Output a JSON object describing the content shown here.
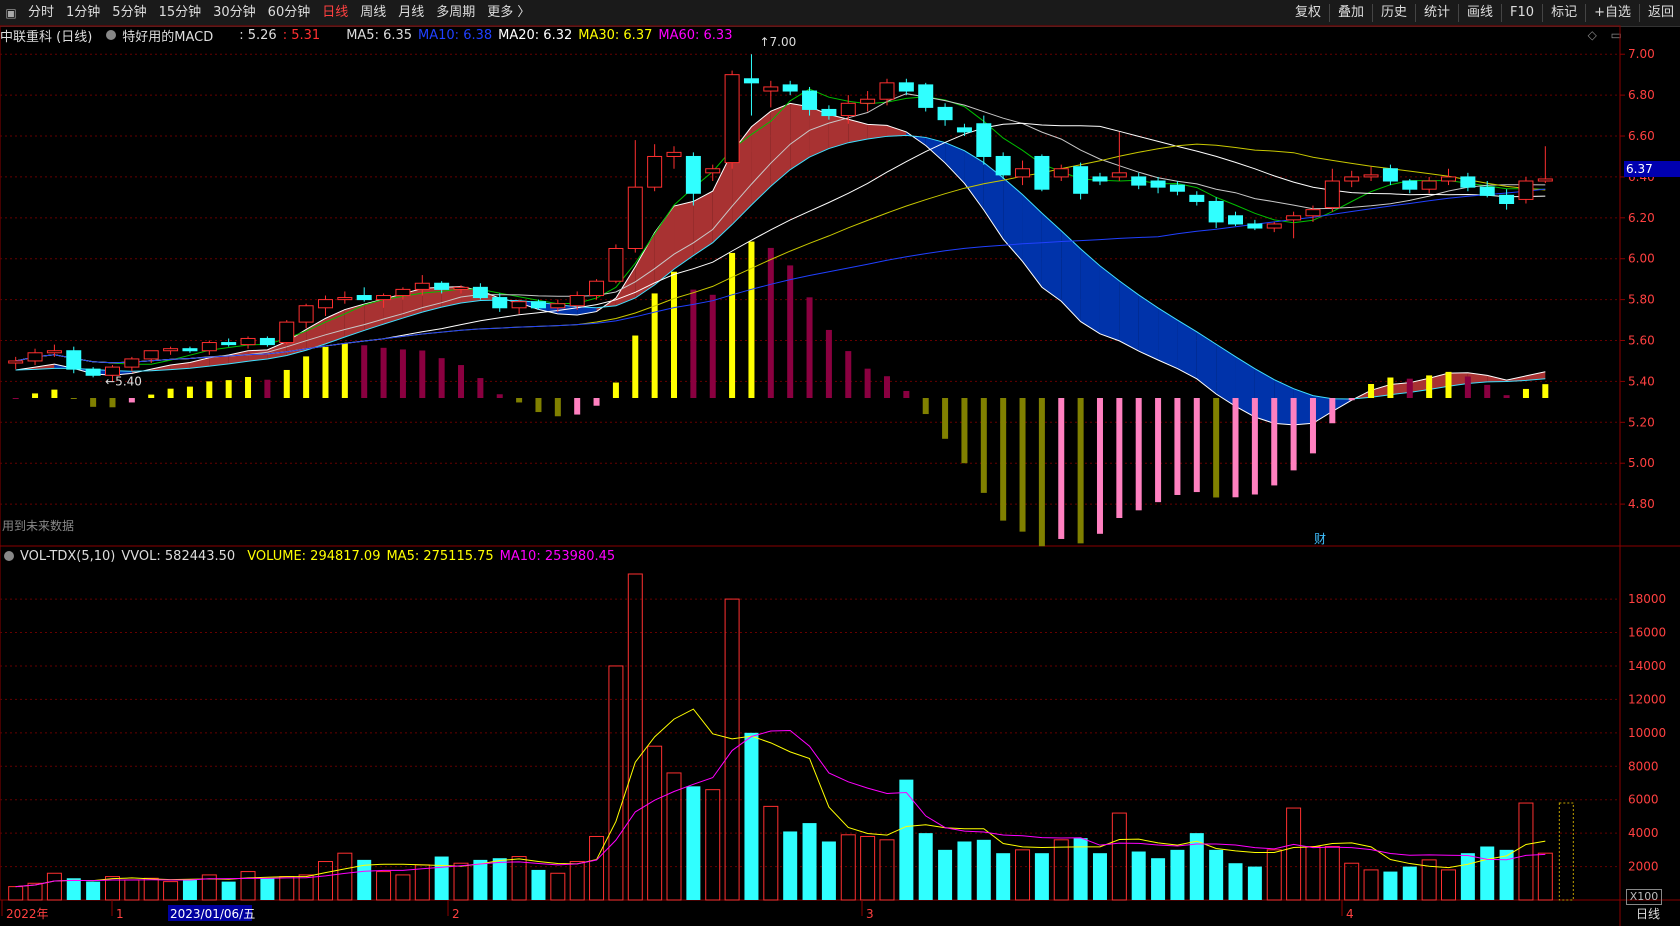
{
  "toolbar": {
    "periods": [
      "分时",
      "1分钟",
      "5分钟",
      "15分钟",
      "30分钟",
      "60分钟",
      "日线",
      "周线",
      "月线",
      "多周期",
      "更多 〉"
    ],
    "active": "日线",
    "right_items": [
      "复权",
      "叠加",
      "历史",
      "统计",
      "画线",
      "F10",
      "标记",
      "+自选",
      "返回"
    ]
  },
  "info": {
    "stock": "中联重科 (日线)",
    "indicator": "特好用的MACD",
    "v1": ": 5.26",
    "v2": ": 5.31",
    "ma5": "MA5: 6.35",
    "ma10": "MA10: 6.38",
    "ma20": "MA20: 6.32",
    "ma30": "MA30: 6.37",
    "ma60": "MA60: 6.33"
  },
  "volinfo": {
    "name": "VOL-TDX(5,10)",
    "vvol": "VVOL: 582443.50",
    "volume": "VOLUME: 294817.09",
    "ma5": "MA5: 275115.75",
    "ma10": "MA10: 253980.45"
  },
  "price_axis": [
    "7.00",
    "6.80",
    "6.60",
    "6.40",
    "6.20",
    "6.00",
    "5.80",
    "5.60",
    "5.40",
    "5.20",
    "5.00",
    "4.80"
  ],
  "volume_axis": [
    "18000",
    "16000",
    "14000",
    "12000",
    "10000",
    "8000",
    "6000",
    "4000",
    "2000"
  ],
  "current_price": "6.37",
  "high_mark": "7.00",
  "low_mark": "5.40",
  "future_note": "用到未来数据",
  "fin_mark": "财",
  "vol_unit": "X100",
  "period_label": "日线",
  "date_axis": {
    "year": "2022年",
    "m1": "1",
    "date": "2023/01/06/五",
    "m2": "2",
    "m3": "3",
    "m4": "4"
  },
  "colors": {
    "up": "#ff3030",
    "down": "#30ffff",
    "ma5": "#e0e0e0",
    "ma10": "#2040ff",
    "ma20": "#ffffff",
    "ma30": "#ffff00",
    "ma60": "#ff00ff",
    "grid": "#660000"
  },
  "chart_data": {
    "type": "candlestick",
    "ylim": [
      4.6,
      7.05
    ],
    "candles": [
      [
        5.49,
        5.52,
        5.46,
        5.5
      ],
      [
        5.5,
        5.56,
        5.48,
        5.54
      ],
      [
        5.54,
        5.58,
        5.52,
        5.55
      ],
      [
        5.55,
        5.57,
        5.44,
        5.46
      ],
      [
        5.46,
        5.47,
        5.42,
        5.43
      ],
      [
        5.43,
        5.48,
        5.4,
        5.47
      ],
      [
        5.47,
        5.52,
        5.45,
        5.51
      ],
      [
        5.51,
        5.55,
        5.49,
        5.55
      ],
      [
        5.55,
        5.57,
        5.53,
        5.56
      ],
      [
        5.56,
        5.57,
        5.54,
        5.55
      ],
      [
        5.55,
        5.6,
        5.53,
        5.59
      ],
      [
        5.59,
        5.61,
        5.57,
        5.58
      ],
      [
        5.58,
        5.62,
        5.56,
        5.61
      ],
      [
        5.61,
        5.62,
        5.57,
        5.58
      ],
      [
        5.59,
        5.7,
        5.58,
        5.69
      ],
      [
        5.69,
        5.78,
        5.66,
        5.77
      ],
      [
        5.76,
        5.82,
        5.72,
        5.8
      ],
      [
        5.8,
        5.84,
        5.78,
        5.81
      ],
      [
        5.82,
        5.86,
        5.79,
        5.8
      ],
      [
        5.8,
        5.83,
        5.76,
        5.82
      ],
      [
        5.82,
        5.86,
        5.8,
        5.85
      ],
      [
        5.85,
        5.92,
        5.82,
        5.88
      ],
      [
        5.88,
        5.89,
        5.83,
        5.85
      ],
      [
        5.85,
        5.87,
        5.83,
        5.86
      ],
      [
        5.86,
        5.88,
        5.8,
        5.81
      ],
      [
        5.81,
        5.83,
        5.74,
        5.76
      ],
      [
        5.76,
        5.8,
        5.73,
        5.79
      ],
      [
        5.79,
        5.8,
        5.75,
        5.76
      ],
      [
        5.76,
        5.8,
        5.74,
        5.78
      ],
      [
        5.77,
        5.84,
        5.75,
        5.82
      ],
      [
        5.82,
        5.9,
        5.8,
        5.89
      ],
      [
        5.89,
        6.07,
        5.88,
        6.05
      ],
      [
        6.05,
        6.58,
        6.03,
        6.35
      ],
      [
        6.35,
        6.56,
        6.33,
        6.5
      ],
      [
        6.5,
        6.55,
        6.44,
        6.52
      ],
      [
        6.5,
        6.52,
        6.26,
        6.32
      ],
      [
        6.42,
        6.46,
        6.38,
        6.44
      ],
      [
        6.47,
        6.92,
        6.44,
        6.9
      ],
      [
        6.88,
        7.0,
        6.7,
        6.86
      ],
      [
        6.82,
        6.87,
        6.74,
        6.84
      ],
      [
        6.85,
        6.87,
        6.8,
        6.82
      ],
      [
        6.82,
        6.84,
        6.7,
        6.73
      ],
      [
        6.73,
        6.75,
        6.68,
        6.7
      ],
      [
        6.7,
        6.8,
        6.66,
        6.76
      ],
      [
        6.76,
        6.82,
        6.72,
        6.78
      ],
      [
        6.78,
        6.88,
        6.75,
        6.86
      ],
      [
        6.86,
        6.88,
        6.8,
        6.82
      ],
      [
        6.85,
        6.86,
        6.72,
        6.74
      ],
      [
        6.74,
        6.76,
        6.65,
        6.68
      ],
      [
        6.64,
        6.66,
        6.6,
        6.62
      ],
      [
        6.66,
        6.7,
        6.46,
        6.5
      ],
      [
        6.5,
        6.52,
        6.39,
        6.41
      ],
      [
        6.4,
        6.48,
        6.36,
        6.44
      ],
      [
        6.5,
        6.51,
        6.33,
        6.34
      ],
      [
        6.4,
        6.46,
        6.38,
        6.44
      ],
      [
        6.45,
        6.47,
        6.29,
        6.32
      ],
      [
        6.4,
        6.42,
        6.36,
        6.38
      ],
      [
        6.4,
        6.62,
        6.38,
        6.42
      ],
      [
        6.4,
        6.42,
        6.34,
        6.36
      ],
      [
        6.38,
        6.4,
        6.32,
        6.35
      ],
      [
        6.36,
        6.38,
        6.31,
        6.33
      ],
      [
        6.31,
        6.33,
        6.26,
        6.28
      ],
      [
        6.28,
        6.3,
        6.15,
        6.18
      ],
      [
        6.21,
        6.23,
        6.16,
        6.17
      ],
      [
        6.17,
        6.19,
        6.14,
        6.15
      ],
      [
        6.15,
        6.18,
        6.13,
        6.17
      ],
      [
        6.19,
        6.23,
        6.1,
        6.21
      ],
      [
        6.21,
        6.26,
        6.18,
        6.24
      ],
      [
        6.25,
        6.44,
        6.23,
        6.38
      ],
      [
        6.38,
        6.43,
        6.35,
        6.4
      ],
      [
        6.4,
        6.45,
        6.38,
        6.41
      ],
      [
        6.44,
        6.46,
        6.36,
        6.38
      ],
      [
        6.38,
        6.39,
        6.32,
        6.34
      ],
      [
        6.34,
        6.4,
        6.32,
        6.38
      ],
      [
        6.38,
        6.44,
        6.36,
        6.4
      ],
      [
        6.4,
        6.42,
        6.33,
        6.35
      ],
      [
        6.35,
        6.38,
        6.3,
        6.31
      ],
      [
        6.31,
        6.34,
        6.24,
        6.27
      ],
      [
        6.29,
        6.4,
        6.27,
        6.38
      ],
      [
        6.38,
        6.55,
        6.37,
        6.39
      ]
    ],
    "volume": [
      8,
      10,
      16,
      13,
      11,
      14,
      12,
      13,
      11,
      12,
      15,
      11,
      17,
      13,
      14,
      15,
      23,
      28,
      24,
      17,
      15,
      21,
      26,
      22,
      24,
      25,
      26,
      18,
      16,
      23,
      38,
      140,
      195,
      92,
      76,
      68,
      66,
      180,
      100,
      56,
      41,
      46,
      35,
      39,
      38,
      36,
      72,
      40,
      30,
      35,
      36,
      28,
      30,
      28,
      36,
      37,
      28,
      52,
      29,
      25,
      30,
      40,
      30,
      22,
      20,
      30,
      55,
      32,
      32,
      22,
      18,
      17,
      20,
      24,
      18,
      28,
      32,
      30,
      58,
      28
    ]
  }
}
